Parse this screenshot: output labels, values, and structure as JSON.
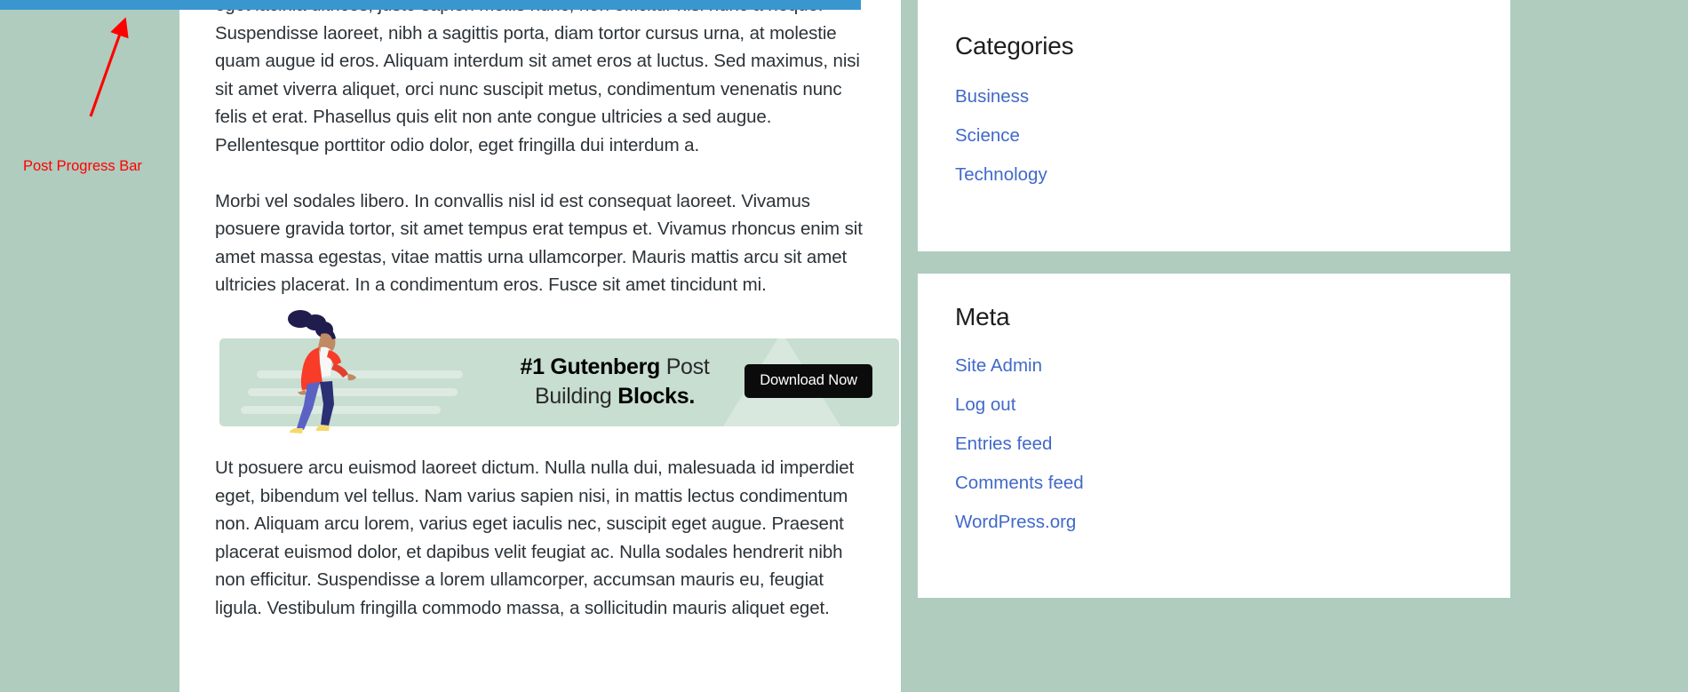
{
  "progress_bar": {
    "percent": 51,
    "fill_color": "#3a96ce",
    "annotation_label": "Post Progress Bar",
    "annotation_color": "#ff0000"
  },
  "theme": {
    "page_background": "#afccbe",
    "content_background": "#ffffff",
    "link_color": "#4169c9",
    "text_color": "#2c3338"
  },
  "article": {
    "paragraphs": [
      "eget lacinia ultrices, justo sapien mollis nunc, non efficitur nisi nunc a neque. Suspendisse laoreet, nibh a sagittis porta, diam tortor cursus urna, at molestie quam augue id eros. Aliquam interdum sit amet eros at luctus. Sed maximus, nisi sit amet viverra aliquet, orci nunc suscipit metus, condimentum venenatis nunc felis et erat. Phasellus quis elit non ante congue ultricies a sed augue. Pellentesque porttitor odio dolor, eget fringilla dui interdum a.",
      "Morbi vel sodales libero. In convallis nisl id est consequat laoreet. Vivamus posuere gravida tortor, sit amet tempus erat tempus et. Vivamus rhoncus enim sit amet massa egestas, vitae mattis urna ullamcorper. Mauris mattis arcu sit amet ultricies placerat. In a condimentum eros. Fusce sit amet tincidunt mi.",
      "Ut posuere arcu euismod laoreet dictum. Nulla nulla dui, malesuada id imperdiet eget, bibendum vel tellus. Nam varius sapien nisi, in mattis lectus condimentum non. Aliquam arcu lorem, varius eget iaculis nec, suscipit eget augue. Praesent placerat euismod dolor, et dapibus velit feugiat ac. Nulla sodales hendrerit nibh non efficitur. Suspendisse a lorem ullamcorper, accumsan mauris eu, feugiat ligula. Vestibulum fringilla commodo massa, a sollicitudin mauris aliquet eget."
    ]
  },
  "banner": {
    "headline_line1_bold": "#1 Gutenberg",
    "headline_line1_light": "Post",
    "headline_line2_light": "Building",
    "headline_line2_bold": "Blocks.",
    "button_label": "Download Now",
    "background_color": "#c7ded1",
    "button_background": "#0b0b0b"
  },
  "sidebar": {
    "widgets": [
      {
        "title": "Categories",
        "items": [
          {
            "label": "Business"
          },
          {
            "label": "Science"
          },
          {
            "label": "Technology"
          }
        ]
      },
      {
        "title": "Meta",
        "items": [
          {
            "label": "Site Admin"
          },
          {
            "label": "Log out"
          },
          {
            "label": "Entries feed"
          },
          {
            "label": "Comments feed"
          },
          {
            "label": "WordPress.org"
          }
        ]
      }
    ]
  }
}
